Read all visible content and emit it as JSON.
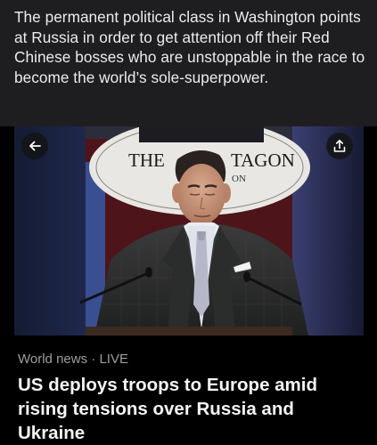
{
  "post": {
    "text": "The permanent political class in Washington points at Russia in order to get attention off their Red Chinese bosses who are unstoppable in the race to become the world’s sole-superpower."
  },
  "card": {
    "seal_text_left": "THE",
    "seal_text_right": "TAGON",
    "seal_text_small": "ON",
    "source": "World news",
    "separator": "·",
    "status": "LIVE",
    "headline": "US deploys troops to Europe amid rising tensions over Russia and Ukraine"
  },
  "icons": {
    "back": "arrow-left-icon",
    "share": "share-upload-icon"
  }
}
